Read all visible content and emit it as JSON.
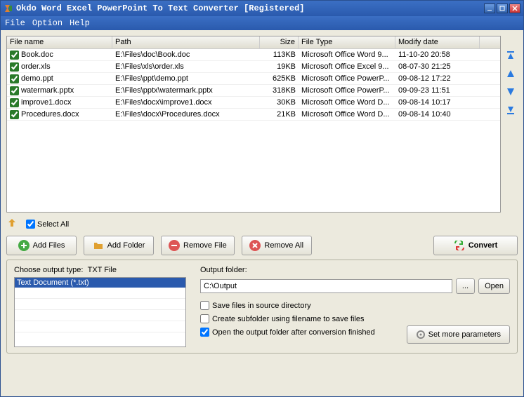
{
  "title": "Okdo Word Excel PowerPoint To Text Converter [Registered]",
  "menu": {
    "file": "File",
    "option": "Option",
    "help": "Help"
  },
  "columns": {
    "name": "File name",
    "path": "Path",
    "size": "Size",
    "type": "File Type",
    "date": "Modify date"
  },
  "files": [
    {
      "name": "Book.doc",
      "path": "E:\\Files\\doc\\Book.doc",
      "size": "113KB",
      "type": "Microsoft Office Word 9...",
      "date": "11-10-20 20:58",
      "checked": true
    },
    {
      "name": "order.xls",
      "path": "E:\\Files\\xls\\order.xls",
      "size": "19KB",
      "type": "Microsoft Office Excel 9...",
      "date": "08-07-30 21:25",
      "checked": true
    },
    {
      "name": "demo.ppt",
      "path": "E:\\Files\\ppt\\demo.ppt",
      "size": "625KB",
      "type": "Microsoft Office PowerP...",
      "date": "09-08-12 17:22",
      "checked": true
    },
    {
      "name": "watermark.pptx",
      "path": "E:\\Files\\pptx\\watermark.pptx",
      "size": "318KB",
      "type": "Microsoft Office PowerP...",
      "date": "09-09-23 11:51",
      "checked": true
    },
    {
      "name": "improve1.docx",
      "path": "E:\\Files\\docx\\improve1.docx",
      "size": "30KB",
      "type": "Microsoft Office Word D...",
      "date": "09-08-14 10:17",
      "checked": true
    },
    {
      "name": "Procedures.docx",
      "path": "E:\\Files\\docx\\Procedures.docx",
      "size": "21KB",
      "type": "Microsoft Office Word D...",
      "date": "09-08-14 10:40",
      "checked": true
    }
  ],
  "selectAll": {
    "label": "Select All",
    "checked": true
  },
  "buttons": {
    "addFiles": "Add Files",
    "addFolder": "Add Folder",
    "removeFile": "Remove File",
    "removeAll": "Remove All",
    "convert": "Convert"
  },
  "outputType": {
    "label": "Choose output type:",
    "current": "TXT File",
    "option": "Text Document (*.txt)"
  },
  "outputFolder": {
    "label": "Output folder:",
    "value": "C:\\Output",
    "browse": "...",
    "open": "Open"
  },
  "options": {
    "saveSource": {
      "label": "Save files in source directory",
      "checked": false
    },
    "createSub": {
      "label": "Create subfolder using filename to save files",
      "checked": false
    },
    "openAfter": {
      "label": "Open the output folder after conversion finished",
      "checked": true
    }
  },
  "setMore": "Set more parameters"
}
